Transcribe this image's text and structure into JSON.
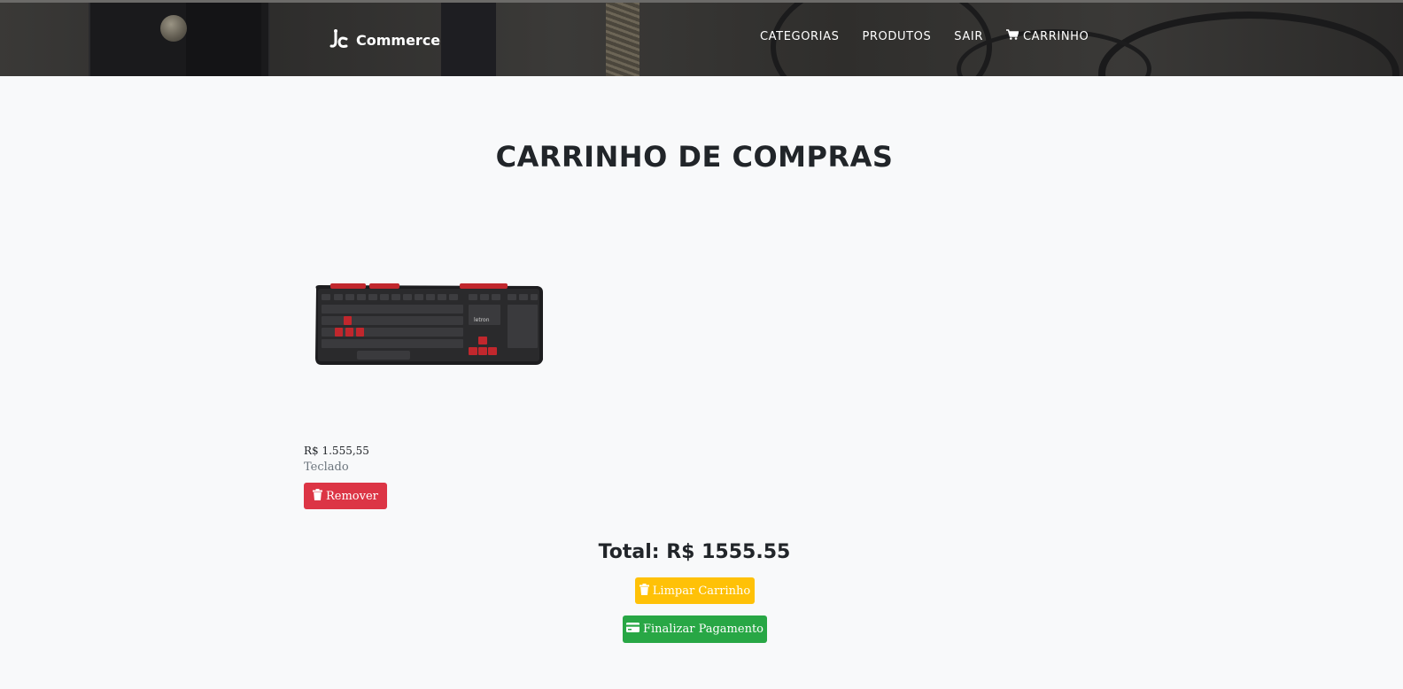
{
  "header": {
    "brand": {
      "text": "Commerce",
      "icon": "jc-logo-icon"
    },
    "nav": [
      {
        "label": "CATEGORIAS"
      },
      {
        "label": "PRODUTOS"
      },
      {
        "label": "SAIR"
      },
      {
        "label": "CARRINHO",
        "icon": "cart-icon"
      }
    ]
  },
  "main": {
    "title": "CARRINHO DE COMPRAS",
    "items": [
      {
        "price": "R$ 1.555,55",
        "name": "Teclado",
        "image_text": "letron",
        "remove_label": "Remover",
        "remove_icon": "trash-icon"
      }
    ],
    "total": "Total: R$ 1555.55",
    "clear_label": "Limpar Carrinho",
    "clear_icon": "trash-icon",
    "checkout_label": "Finalizar Pagamento",
    "checkout_icon": "credit-card-icon"
  },
  "colors": {
    "danger": "#dc3545",
    "warning": "#ffc107",
    "success": "#28a745",
    "page_bg": "#f8f9fa"
  }
}
